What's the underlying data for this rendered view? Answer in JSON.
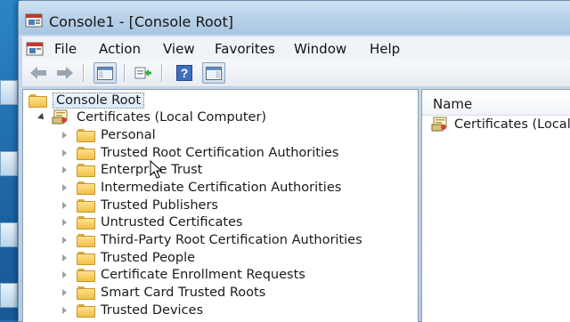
{
  "window": {
    "title": "Console1 - [Console Root]"
  },
  "menubar": {
    "items": [
      "File",
      "Action",
      "View",
      "Favorites",
      "Window",
      "Help"
    ]
  },
  "toolbar": {
    "buttons": [
      "back-arrow-icon",
      "forward-arrow-icon",
      "show-hide-console-tree-icon",
      "export-list-icon",
      "help-icon",
      "show-hide-action-pane-icon"
    ]
  },
  "tree": {
    "root_label": "Console Root",
    "certificates_label": "Certificates (Local Computer)",
    "stores": [
      "Personal",
      "Trusted Root Certification Authorities",
      "Enterprise Trust",
      "Intermediate Certification Authorities",
      "Trusted Publishers",
      "Untrusted Certificates",
      "Third-Party Root Certification Authorities",
      "Trusted People",
      "Certificate Enrollment Requests",
      "Smart Card Trusted Roots",
      "Trusted Devices"
    ]
  },
  "details": {
    "column_name": "Name",
    "items": [
      "Certificates (Local"
    ]
  },
  "colors": {
    "titlebar": "#b5cfe8",
    "folder": "#f0c04a",
    "selection": "#dbe9f7"
  }
}
